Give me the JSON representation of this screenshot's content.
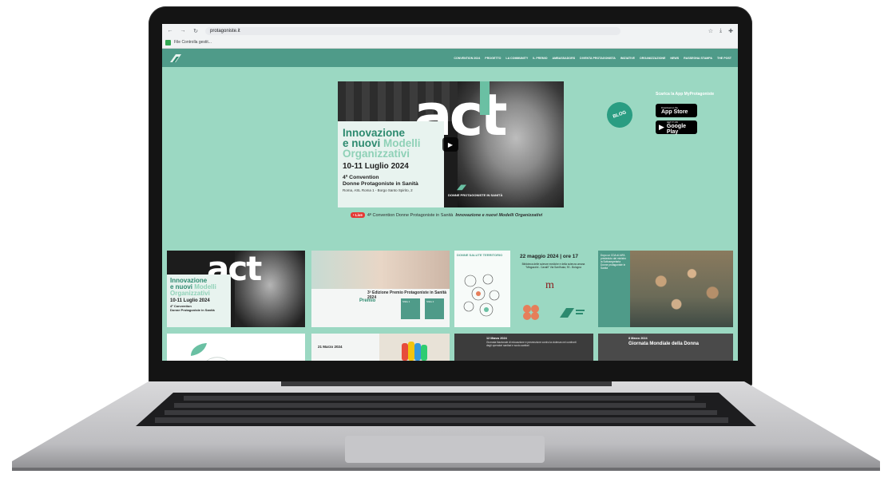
{
  "browser": {
    "url": "protagoniste.it",
    "bookmark": "File Controlla gestit..."
  },
  "nav": {
    "items": [
      "CONVENTION 2024",
      "PROGETTO",
      "LA COMMUNITY",
      "IL PREMIO",
      "AMBASSADORS",
      "DIVENTA PROTAGONISTA",
      "INIZIATIVE",
      "ORGANIZZAZIONE",
      "NEWS",
      "RASSEGNA STAMPA",
      "THE POST"
    ]
  },
  "hero": {
    "act": "act",
    "title_line1": "Innovazione",
    "title_line2a": "e nuovi",
    "title_line2b": "Modelli",
    "title_line3": "Organizzativi",
    "date": "10-11 Luglio 2024",
    "convention_line1": "4ª Convention",
    "convention_line2": "Donne Protagoniste in Sanità",
    "place": "Roma, ASL Roma 1 - Borgo Santo Spirito, 2",
    "brand": "DONNE PROTAGONISTE IN SANITÀ"
  },
  "caption": {
    "live": "• Live",
    "text": "4ª Convention Donne Protagoniste in Sanità",
    "italic": "Innovazione e nuovi Modelli Organizzativi"
  },
  "side": {
    "blog": "BLOG",
    "app_title": "Scarica la App MyProtagoniste",
    "appstore_small": "Download on the",
    "appstore_big": "App Store",
    "googleplay_small": "GET IT ON",
    "googleplay_big": "Google Play"
  },
  "tiles": {
    "t1_act": "act",
    "t1_title1": "Innovazione",
    "t1_title2a": "e nuovi",
    "t1_title2b": "Modelli",
    "t1_title3": "Organizzativi",
    "t1_date": "10-11 Luglio 2024",
    "t1_conv1": "4ª Convention",
    "t1_conv2": "Donne Protagoniste in Sanità",
    "t2_title": "3ª Edizione Premio Protagoniste in Sanità 2024",
    "t2_premio": "Premio",
    "t2_box1": "Sfida 1",
    "t2_box2": "Sfida 2",
    "t3_label": "DONNE SALUTE TERRITORIO",
    "t4_date": "22 maggio 2024 | ore 17",
    "t4_sub": "Biblioteca delle scienze mediche e della scienza umana \"Mingazzini - Cavalli\" Via Sant'Isaia, 90 - Bologna",
    "t4_m": "m",
    "t5_text": "Dopo un CDA di AIFA presieduto dal ministro la Sottosegretaria Donne protagoniste in Sanità",
    "t7_date": "21 Marzo 2024",
    "t9_date": "12 Marzo 2024",
    "t9_text": "Giornata Nazionale di educazione e prevenzione contro la violenza nei confronti degli operatori sanitari e socio-sanitari",
    "t10_date": "8 Marzo 2024",
    "t10_text": "Giornata Mondiale della Donna"
  },
  "colors": {
    "page_bg": "#9bd8c2",
    "nav_bg": "#4f9b89",
    "accent": "#2d8a6f",
    "live": "#e53935"
  }
}
